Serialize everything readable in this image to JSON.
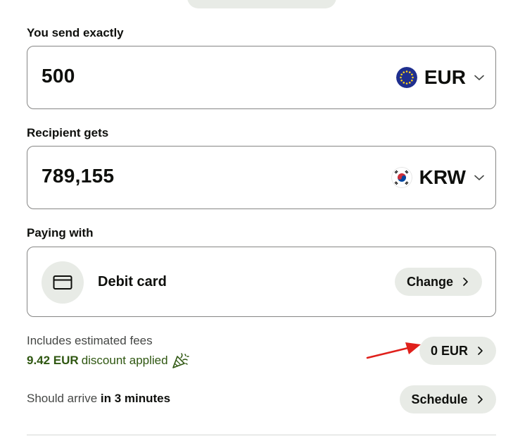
{
  "send": {
    "label": "You send exactly",
    "amount": "500",
    "currency": "EUR",
    "flag_icon": "eu-flag-icon"
  },
  "receive": {
    "label": "Recipient gets",
    "amount": "789,155",
    "currency": "KRW",
    "flag_icon": "south-korea-flag-icon"
  },
  "payment": {
    "label": "Paying with",
    "method": "Debit card",
    "method_icon": "credit-card-icon",
    "change_label": "Change"
  },
  "fees": {
    "label": "Includes estimated fees",
    "discount_amount": "9.42 EUR",
    "discount_text": "discount applied",
    "fee_button_label": "0 EUR",
    "celebration_icon": "party-popper-icon"
  },
  "arrival": {
    "prefix": "Should arrive",
    "time": "in 3 minutes",
    "schedule_label": "Schedule"
  },
  "colors": {
    "border": "#868685",
    "pill_bg": "#e8ebe6",
    "discount_green": "#2f5711",
    "annotation_red": "#e0201b"
  }
}
